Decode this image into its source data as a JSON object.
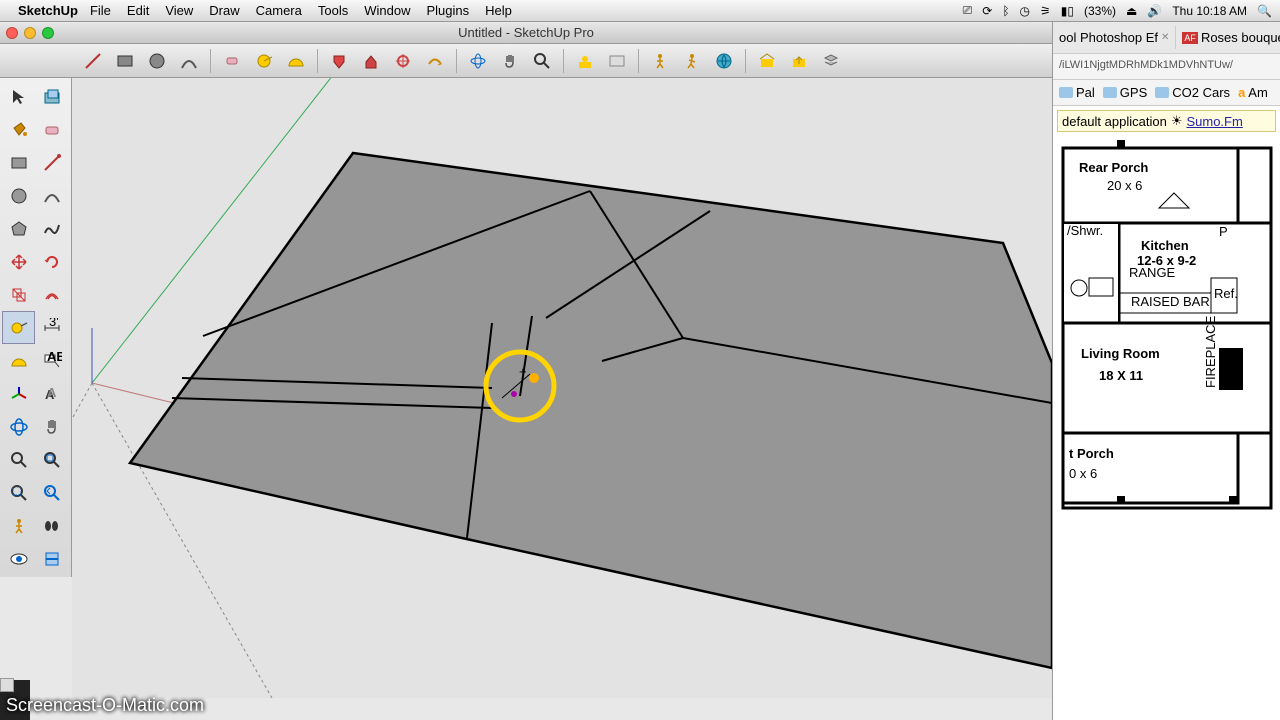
{
  "menubar": {
    "app": "SketchUp",
    "items": [
      "File",
      "Edit",
      "View",
      "Draw",
      "Camera",
      "Tools",
      "Window",
      "Plugins",
      "Help"
    ],
    "battery": "(33%)",
    "clock": "Thu 10:18 AM"
  },
  "window": {
    "title": "Untitled - SketchUp Pro"
  },
  "toolbar_icons": [
    "line",
    "rectangle",
    "circle",
    "arc",
    "sep",
    "eraser",
    "tape",
    "protractor",
    "sep",
    "paint",
    "sample",
    "axes",
    "rotate",
    "followme",
    "sep",
    "orbit",
    "pan",
    "zoom",
    "sep",
    "position-camera",
    "walk",
    "sep",
    "layers",
    "model-info",
    "sep",
    "shadows",
    "fog",
    "xray"
  ],
  "left_tools": [
    "select",
    "make-component",
    "paint-bucket",
    "eraser",
    "rectangle",
    "line",
    "circle",
    "arc",
    "polygon",
    "freehand",
    "move",
    "rotate",
    "scale",
    "offset",
    "tape-measure",
    "dimensions",
    "protractor",
    "text",
    "axes",
    "3d-text",
    "orbit",
    "pan",
    "zoom",
    "zoom-extents",
    "zoom-window",
    "previous",
    "position-camera",
    "walk",
    "look-around",
    "section-plane"
  ],
  "active_tool": "tape-measure",
  "browser": {
    "tabs": [
      {
        "label": "ool Photoshop Ef",
        "close": true
      },
      {
        "label": "Roses bouquet",
        "close": false
      }
    ],
    "url": "/iLWI1NjgtMDRhMDk1MDVhNTUw/",
    "bookmarks": [
      "Pal",
      "GPS",
      "CO2 Cars",
      "Am"
    ],
    "appbar_pre": "default application",
    "appbar_link": "Sumo.Fm"
  },
  "floorplan": {
    "rooms": [
      {
        "name": "Rear Porch",
        "dim": "20 x 6"
      },
      {
        "name": "Kitchen",
        "dim": "12-6 x 9-2"
      },
      {
        "name": "Living Room",
        "dim": "18 X 11"
      },
      {
        "name": "t Porch",
        "dim": "0 x 6"
      }
    ],
    "labels": {
      "shower": "/Shwr.",
      "range": "RANGE",
      "raised_bar": "RAISED BAR",
      "ref": "Ref.",
      "p": "P",
      "fireplace": "FIREPLACE"
    }
  },
  "watermark": "Screencast-O-Matic.com"
}
